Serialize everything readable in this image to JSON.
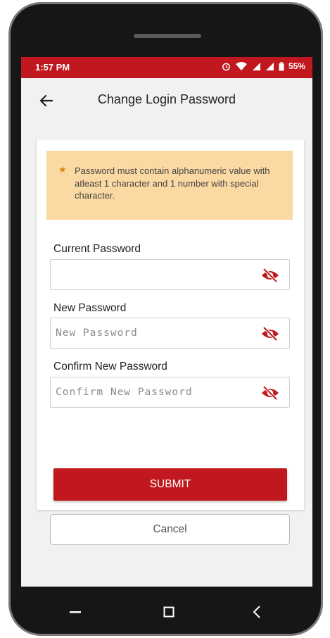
{
  "status_bar": {
    "time": "1:57 PM",
    "battery": "55%",
    "icons": [
      "alarm-icon",
      "wifi-icon",
      "signal-icon",
      "signal-icon",
      "battery-icon"
    ],
    "background_color": "#c0181e"
  },
  "header": {
    "title": "Change Login Password",
    "back_icon": "back-arrow-icon"
  },
  "notice": {
    "star": "★",
    "text": "Password must contain alphanumeric value with atleast 1 character and 1 number with special character.",
    "background_color": "#fbd9a3"
  },
  "form": {
    "current_password": {
      "label": "Current Password",
      "value": "",
      "placeholder": ""
    },
    "new_password": {
      "label": "New Password",
      "value": "",
      "placeholder": "New Password"
    },
    "confirm_password": {
      "label": "Confirm New Password",
      "value": "",
      "placeholder": "Confirm New Password"
    },
    "visibility_icon": "eye-off-icon",
    "submit_label": "SUBMIT",
    "cancel_label": "Cancel"
  },
  "nav_bar": {
    "icons": [
      "recent-apps-icon",
      "home-icon",
      "back-icon"
    ]
  },
  "colors": {
    "accent": "#c0181e",
    "notice": "#fbd9a3",
    "page_bg": "#f1f1f1"
  }
}
